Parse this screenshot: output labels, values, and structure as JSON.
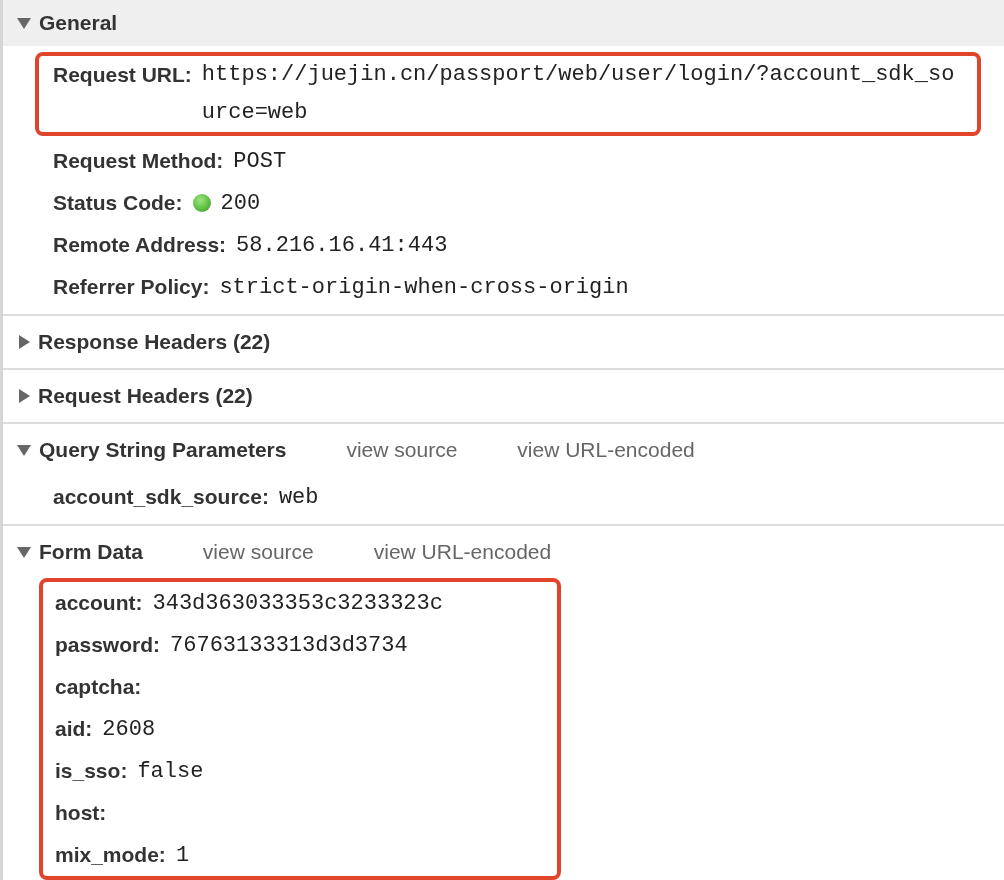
{
  "sections": [
    {
      "title": "General",
      "expanded": true,
      "shaded": true,
      "highlighted": false,
      "rows": [
        {
          "key": "Request URL:",
          "value": "https://juejin.cn/passport/web/user/login/?account_sdk_source=web",
          "highlighted": true,
          "status_dot": false
        },
        {
          "key": "Request Method:",
          "value": "POST",
          "highlighted": false,
          "status_dot": false
        },
        {
          "key": "Status Code:",
          "value": "200",
          "highlighted": false,
          "status_dot": true
        },
        {
          "key": "Remote Address:",
          "value": "58.216.16.41:443",
          "highlighted": false,
          "status_dot": false
        },
        {
          "key": "Referrer Policy:",
          "value": "strict-origin-when-cross-origin",
          "highlighted": false,
          "status_dot": false
        }
      ]
    },
    {
      "title": "Response Headers (22)",
      "expanded": false,
      "shaded": false
    },
    {
      "title": "Request Headers (22)",
      "expanded": false,
      "shaded": false
    },
    {
      "title": "Query String Parameters",
      "expanded": true,
      "shaded": false,
      "links": [
        "view source",
        "view URL-encoded"
      ],
      "highlighted": false,
      "rows": [
        {
          "key": "account_sdk_source:",
          "value": "web",
          "highlighted": false,
          "status_dot": false
        }
      ]
    },
    {
      "title": "Form Data",
      "expanded": true,
      "shaded": false,
      "links": [
        "view source",
        "view URL-encoded"
      ],
      "highlighted": true,
      "rows": [
        {
          "key": "account:",
          "value": "343d363033353c3233323c",
          "highlighted": false,
          "status_dot": false
        },
        {
          "key": "password:",
          "value": "76763133313d3d3734",
          "highlighted": false,
          "status_dot": false
        },
        {
          "key": "captcha:",
          "value": "",
          "highlighted": false,
          "status_dot": false
        },
        {
          "key": "aid:",
          "value": "2608",
          "highlighted": false,
          "status_dot": false
        },
        {
          "key": "is_sso:",
          "value": "false",
          "highlighted": false,
          "status_dot": false
        },
        {
          "key": "host:",
          "value": "",
          "highlighted": false,
          "status_dot": false
        },
        {
          "key": "mix_mode:",
          "value": "1",
          "highlighted": false,
          "status_dot": false
        }
      ]
    }
  ]
}
